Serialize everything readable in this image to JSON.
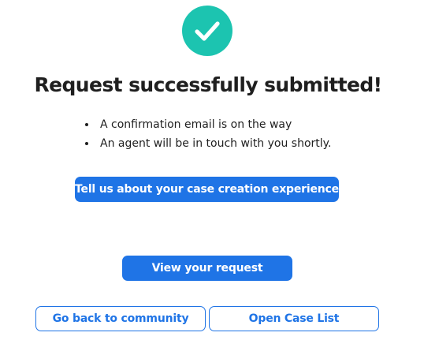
{
  "colors": {
    "success": "#1cc4b0",
    "primary": "#1f74e6",
    "text": "#1f1f1f"
  },
  "icon": "check-circle-icon",
  "title": "Request successfully submitted!",
  "bullets": [
    "A confirmation email is on the way",
    "An agent will be in touch with you shortly."
  ],
  "buttons": {
    "feedback": "Tell us about your case creation experience",
    "view_request": "View your request",
    "community": "Go back to community",
    "case_list": "Open Case List"
  }
}
